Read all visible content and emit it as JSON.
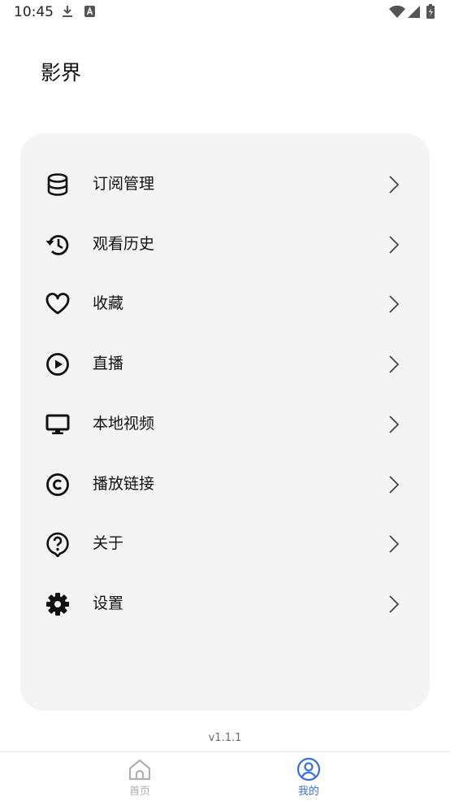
{
  "status_bar": {
    "time": "10:45",
    "icons": [
      "download-icon",
      "font-badge-icon",
      "wifi-icon",
      "cell-signal-icon",
      "battery-charging-icon"
    ]
  },
  "app": {
    "title": "影界"
  },
  "menu": {
    "items": [
      {
        "label": "订阅管理",
        "icon": "database-icon"
      },
      {
        "label": "观看历史",
        "icon": "history-icon"
      },
      {
        "label": "收藏",
        "icon": "heart-icon"
      },
      {
        "label": "直播",
        "icon": "play-circle-icon"
      },
      {
        "label": "本地视频",
        "icon": "monitor-icon"
      },
      {
        "label": "播放链接",
        "icon": "copyright-icon"
      },
      {
        "label": "关于",
        "icon": "help-bubble-icon"
      },
      {
        "label": "设置",
        "icon": "gear-icon"
      }
    ]
  },
  "footer": {
    "version": "v1.1.1"
  },
  "bottom_nav": {
    "tabs": [
      {
        "label": "首页",
        "icon": "home-icon",
        "active": false
      },
      {
        "label": "我的",
        "icon": "user-circle-icon",
        "active": true
      }
    ]
  },
  "colors": {
    "accent": "#3b6fd8",
    "inactive": "#b0b0b0",
    "card_bg": "#f4f4f4"
  }
}
